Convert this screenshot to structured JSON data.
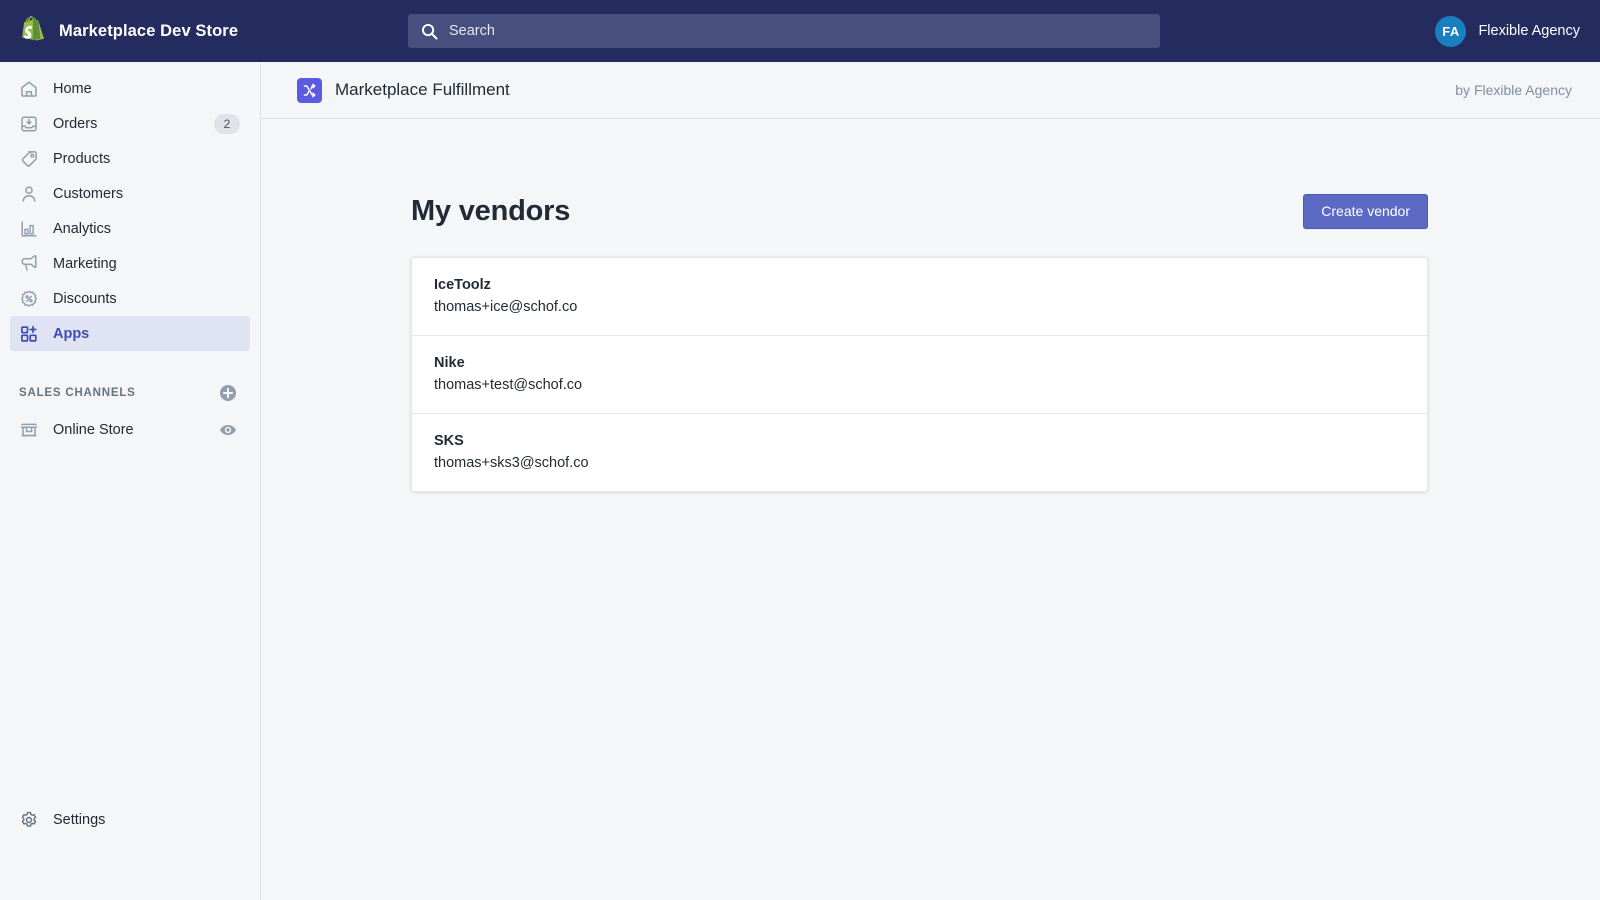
{
  "topbar": {
    "logo_icon": "shopify-bag-icon",
    "store_name": "Marketplace Dev Store",
    "search": {
      "icon": "search-icon",
      "placeholder": "Search",
      "value": ""
    },
    "account": {
      "avatar_initials": "FA",
      "name": "Flexible Agency",
      "avatar_color": "#1a7fc1"
    },
    "background_color": "#242b5e"
  },
  "sidebar": {
    "items": [
      {
        "label": "Home",
        "icon": "home-icon",
        "badge": null,
        "selected": false
      },
      {
        "label": "Orders",
        "icon": "orders-inbox-icon",
        "badge": "2",
        "selected": false
      },
      {
        "label": "Products",
        "icon": "tag-icon",
        "badge": null,
        "selected": false
      },
      {
        "label": "Customers",
        "icon": "person-icon",
        "badge": null,
        "selected": false
      },
      {
        "label": "Analytics",
        "icon": "bar-chart-icon",
        "badge": null,
        "selected": false
      },
      {
        "label": "Marketing",
        "icon": "megaphone-icon",
        "badge": null,
        "selected": false
      },
      {
        "label": "Discounts",
        "icon": "discount-percent-icon",
        "badge": null,
        "selected": false
      },
      {
        "label": "Apps",
        "icon": "apps-grid-plus-icon",
        "badge": null,
        "selected": true
      }
    ],
    "sales_channels": {
      "title": "SALES CHANNELS",
      "add_icon": "plus-circle-icon",
      "channels": [
        {
          "label": "Online Store",
          "icon": "storefront-icon",
          "action_icon": "eye-icon"
        }
      ]
    },
    "settings": {
      "label": "Settings",
      "icon": "gear-icon"
    },
    "selected_background": "#dfe3f3",
    "selected_text_color": "#3f4eae"
  },
  "app_header": {
    "icon": "shuffle-arrows-icon",
    "icon_color": "#5c5ce0",
    "title": "Marketplace Fulfillment",
    "author": "by Flexible Agency"
  },
  "main": {
    "page_title": "My vendors",
    "create_button": "Create vendor",
    "create_button_color": "#5c6ac4",
    "vendors": [
      {
        "name": "IceToolz",
        "email": "thomas+ice@schof.co"
      },
      {
        "name": "Nike",
        "email": "thomas+test@schof.co"
      },
      {
        "name": "SKS",
        "email": "thomas+sks3@schof.co"
      }
    ]
  }
}
